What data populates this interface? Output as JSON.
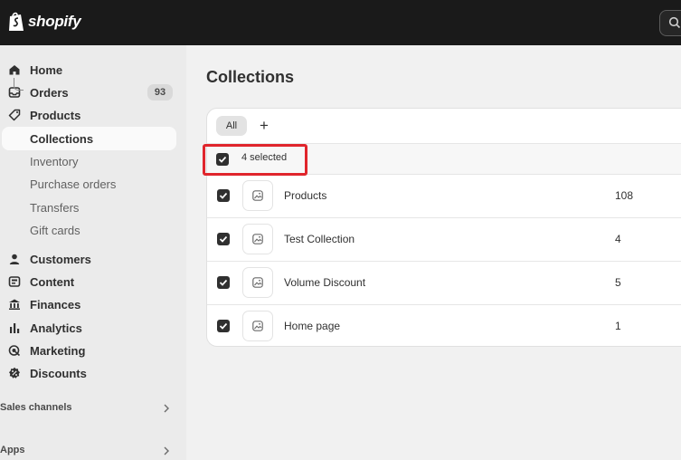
{
  "header": {
    "brand": "shopify",
    "search_icon": "search-icon"
  },
  "sidebar": {
    "items": [
      {
        "label": "Home",
        "icon": "home-icon"
      },
      {
        "label": "Orders",
        "icon": "orders-icon",
        "badge": "93"
      },
      {
        "label": "Products",
        "icon": "tag-icon"
      },
      {
        "label": "Collections"
      },
      {
        "label": "Inventory"
      },
      {
        "label": "Purchase orders"
      },
      {
        "label": "Transfers"
      },
      {
        "label": "Gift cards"
      },
      {
        "label": "Customers",
        "icon": "person-icon"
      },
      {
        "label": "Content",
        "icon": "content-icon"
      },
      {
        "label": "Finances",
        "icon": "bank-icon"
      },
      {
        "label": "Analytics",
        "icon": "bar-chart-icon"
      },
      {
        "label": "Marketing",
        "icon": "target-icon"
      },
      {
        "label": "Discounts",
        "icon": "discount-icon"
      }
    ],
    "sections": {
      "sales_channels": "Sales channels",
      "apps": "Apps"
    }
  },
  "main": {
    "title": "Collections",
    "tabs": [
      {
        "label": "All"
      },
      {
        "label": "+"
      }
    ],
    "selection": {
      "text": "4 selected",
      "checked": true
    },
    "rows": [
      {
        "title": "Products",
        "count": "108",
        "checked": true
      },
      {
        "title": "Test Collection",
        "count": "4",
        "checked": true
      },
      {
        "title": "Volume Discount",
        "count": "5",
        "checked": true
      },
      {
        "title": "Home page",
        "count": "1",
        "checked": true
      }
    ]
  },
  "colors": {
    "topbar": "#1a1a1a",
    "sidebar": "#ebebeb",
    "checkbox": "#303030",
    "highlight": "#e0252c"
  }
}
